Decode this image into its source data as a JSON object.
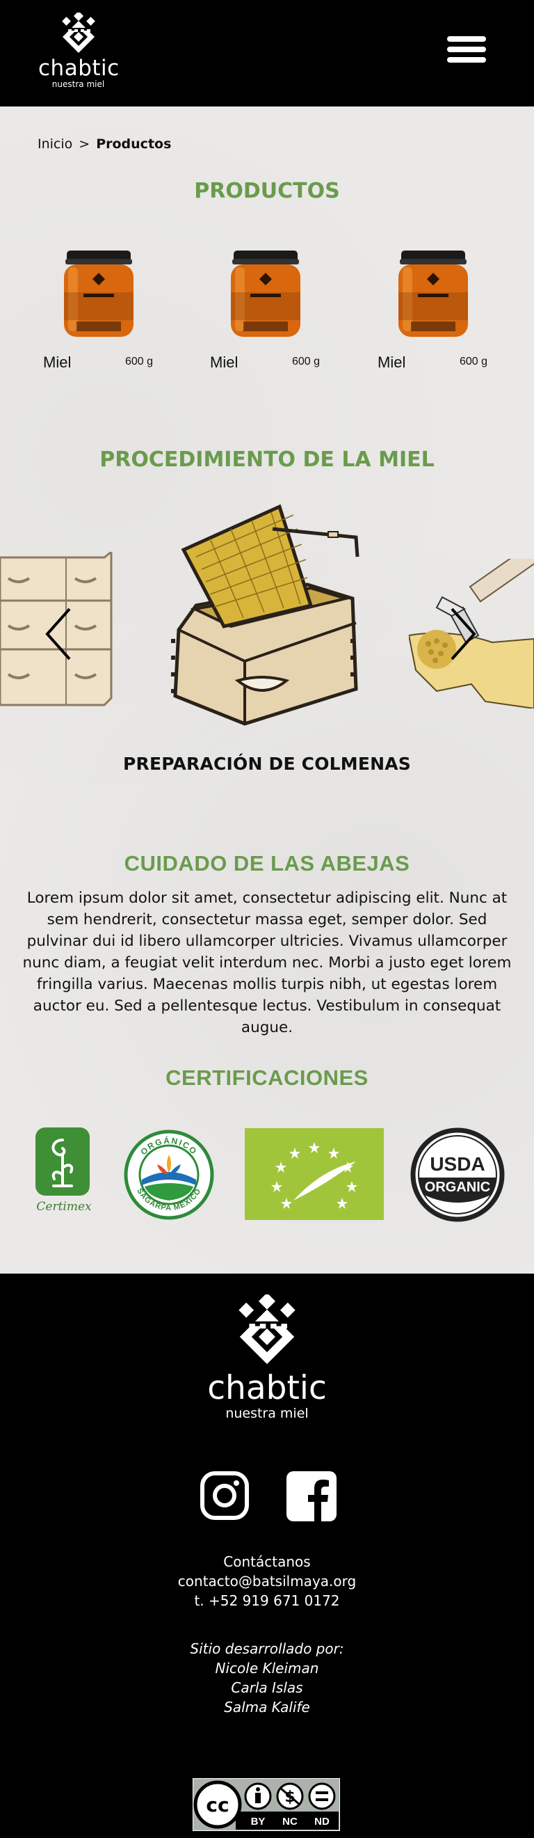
{
  "header": {
    "brand": "chabtic",
    "tagline": "nuestra miel",
    "menu_icon": "hamburger-menu-icon"
  },
  "breadcrumb": {
    "home": "Inicio",
    "separator": ">",
    "current": "Productos"
  },
  "products": {
    "title": "PRODUCTOS",
    "items": [
      {
        "name": "Miel",
        "weight": "600 g"
      },
      {
        "name": "Miel",
        "weight": "600 g"
      },
      {
        "name": "Miel",
        "weight": "600 g"
      }
    ]
  },
  "procedure": {
    "title": "PROCEDIMIENTO DE LA MIEL",
    "current_step": "PREPARACIÓN DE COLMENAS",
    "prev_icon": "chevron-left-icon",
    "next_icon": "chevron-right-icon"
  },
  "bees": {
    "title": "CUIDADO DE LAS ABEJAS",
    "text": "Lorem ipsum dolor sit amet, consectetur adipiscing elit. Nunc at sem hendrerit, consectetur massa eget, semper dolor. Sed pulvinar dui id libero ullamcorper ultricies. Vivamus ullamcorper nunc diam, a feugiat velit interdum nec. Morbi a justo eget lorem fringilla varius. Maecenas mollis turpis nibh, ut egestas lorem auctor eu. Sed a pellentesque lectus. Vestibulum in consequat augue."
  },
  "certifications": {
    "title": "CERTIFICACIONES",
    "certimex": "Certimex",
    "organico_top": "ORGÁNICO",
    "organico_bottom": "SAGARPA MÉXICO",
    "usda_top": "USDA",
    "usda_bottom": "ORGANIC"
  },
  "footer": {
    "brand": "chabtic",
    "tagline": "nuestra miel",
    "contact_label": "Contáctanos",
    "email": "contacto@batsilmaya.org",
    "phone": "t. +52 919 671 0172",
    "credits_label": "Sitio desarrollado por:",
    "developers": [
      "Nicole Kleiman",
      "Carla Islas",
      "Salma Kalife"
    ],
    "license": {
      "by": "BY",
      "nc": "NC",
      "nd": "ND",
      "cc": "cc"
    }
  },
  "colors": {
    "accent_green": "#6a9b4d",
    "honey": "#e07a12",
    "background": "#eae9e7",
    "footer": "#000000"
  }
}
